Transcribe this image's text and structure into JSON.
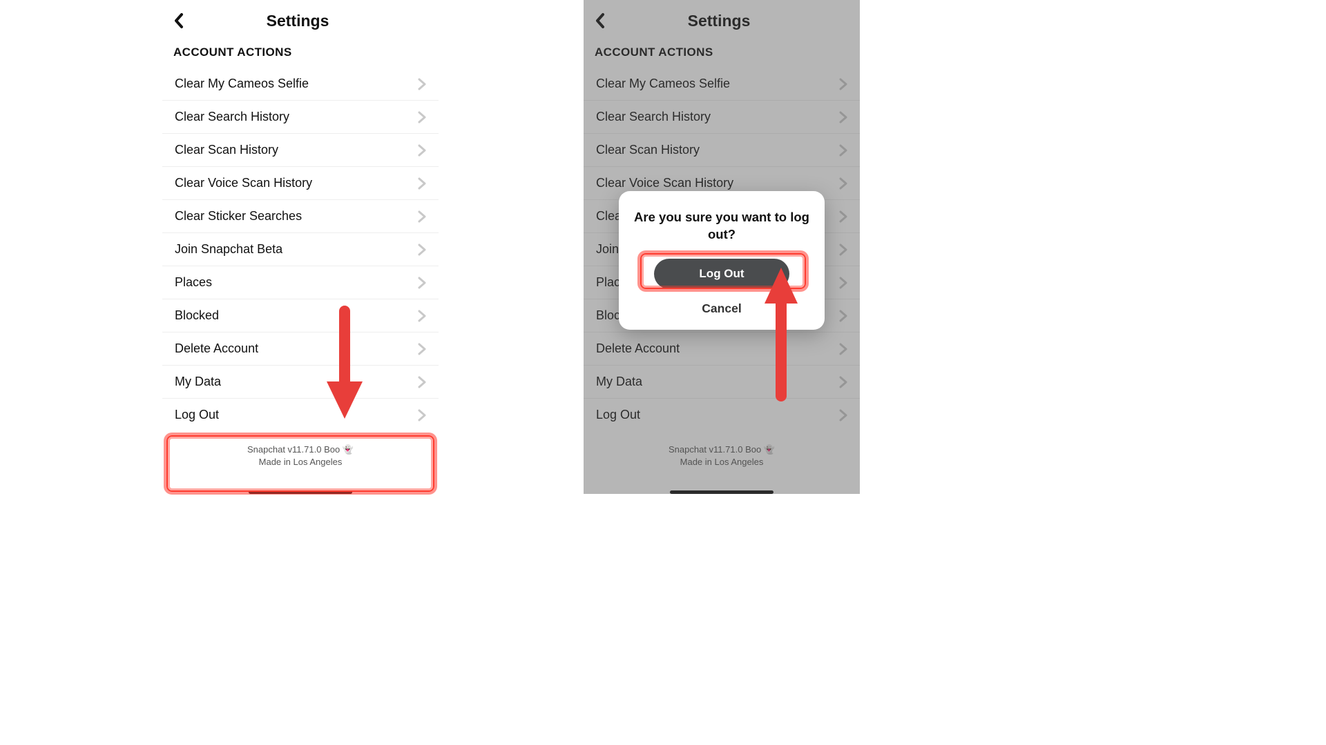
{
  "header": {
    "title": "Settings"
  },
  "section_label": "ACCOUNT ACTIONS",
  "rows": [
    {
      "label": "Clear My Cameos Selfie"
    },
    {
      "label": "Clear Search History"
    },
    {
      "label": "Clear Scan History"
    },
    {
      "label": "Clear Voice Scan History"
    },
    {
      "label": "Clear Sticker Searches"
    },
    {
      "label": "Join Snapchat Beta"
    },
    {
      "label": "Places"
    },
    {
      "label": "Blocked"
    },
    {
      "label": "Delete Account"
    },
    {
      "label": "My Data"
    },
    {
      "label": "Log Out"
    }
  ],
  "footer": {
    "line1": "Snapchat v11.71.0 Boo 👻",
    "line2": "Made in Los Angeles"
  },
  "modal": {
    "title": "Are you sure you want to log out?",
    "confirm": "Log Out",
    "cancel": "Cancel"
  },
  "colors": {
    "accent": "#ff3b2f"
  }
}
